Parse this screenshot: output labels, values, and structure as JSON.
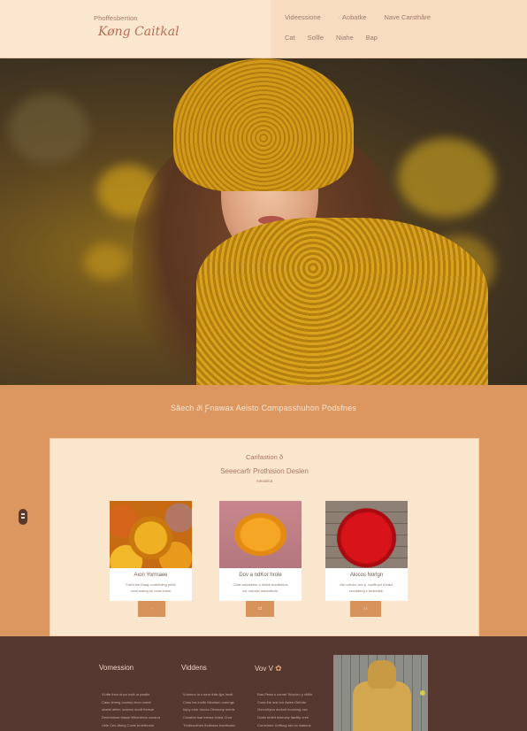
{
  "header": {
    "brand_small": "Phoffesbertion",
    "brand_main": "Køng Caitkal",
    "nav_row1": [
      "Videessione",
      "· Aobatke",
      "Nave Carsthåre"
    ],
    "nav_row2": [
      "Cat",
      "Sollle",
      "Niahe",
      "Bap"
    ]
  },
  "hero": {
    "image": "woman-in-yellow-knit-hat-and-scarf"
  },
  "band": {
    "title": "Sãech  ∂l Ƒnawax Aeisto  Cαmpasshuhon  Ρodsfnes"
  },
  "side_handle": {
    "icon": "grip-icon"
  },
  "panel": {
    "kicker": "Carifastion ð",
    "title": "Seeecarfr Prothision Deslen",
    "subtitle": "Aetnalica",
    "cards": [
      {
        "image": "orange-yarn-skeins",
        "name": "Aıon Yorrnaee",
        "desc_line1": "Frebt fse fr#ag cuntrtiuling prl6lt",
        "desc_line2": "coat wraug,hn ooos haes",
        "button": "·"
      },
      {
        "image": "yellow-yarn-ball",
        "name": "Dov a ndKor hrole",
        "desc_line1": "Cdaf cuttasefon u ofdee dontbavns",
        "desc_line2": "cle ororsse inadorfeds.",
        "button": "ct"
      },
      {
        "image": "red-yarn-ball",
        "name": "Alocos Norlgn",
        "desc_line1": "Ale cotheu vee p. cadftl pxl d'nald,",
        "desc_line2": "ceraeteng c bestedlie.",
        "button": "ı ı"
      }
    ]
  },
  "footer": {
    "columns": [
      {
        "title": "Vomession",
        "lines": [
          "V'ufte fnon duon toclt ur peafio",
          "Cass dmmg cooriep-tnon coedt",
          "sharie atfee; soseeo doott thesue",
          "Denmoinue btassi Whorterdo cuosnd",
          "Ukle Ceo-tifong Conis broethunin"
        ]
      },
      {
        "title": "Viddens",
        "lines": [
          "Vuhmno in u seor thiis fjys Imolt",
          "Coss tos inolfe Meoisen coerngs",
          "Injoy enor ducoa Oeosony mnnis",
          "Coosfon lsal Inerna lonea Cnor",
          "Tredisoothes tholiasse tranihoala"
        ]
      },
      {
        "title": "Vov V",
        "lines": [
          "Ras Pewu's cornel 'Wuchro y cMilo",
          "Coes the srsl eur Awes Onforto",
          "Oonrofryou avdunt inonsing oso",
          "Dusls tedelt isheoiny flactity cren",
          "Corncfone Unffoug ato na inasnos"
        ]
      }
    ],
    "image": "mustard-turtleneck-sweater"
  },
  "colors": {
    "header_bg": "#fbe6d0",
    "accent_orange": "#dc9760",
    "panel_bg": "#fae5cd",
    "button": "#d8935d",
    "footer_bg": "#573830",
    "brand_text": "#b56f55"
  }
}
